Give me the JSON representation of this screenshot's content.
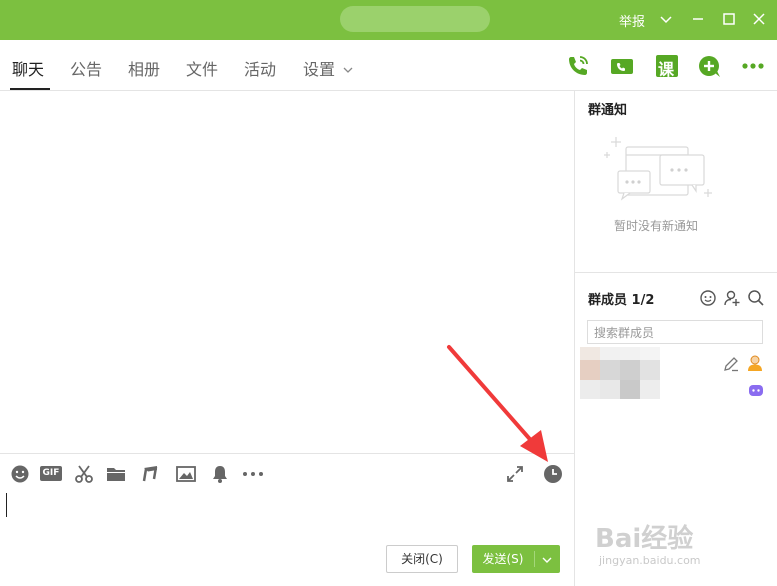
{
  "window": {
    "title_bar_color": "#7cc040",
    "report_label": "举报",
    "controls": [
      "chevron-down-icon",
      "minimize-icon",
      "maximize-icon",
      "close-icon"
    ]
  },
  "tabs": [
    {
      "label": "聊天",
      "active": true
    },
    {
      "label": "公告",
      "active": false
    },
    {
      "label": "相册",
      "active": false
    },
    {
      "label": "文件",
      "active": false
    },
    {
      "label": "活动",
      "active": false
    },
    {
      "label": "设置",
      "active": false
    }
  ],
  "top_actions": [
    "phone-call-icon",
    "video-call-icon",
    "lesson-icon",
    "add-icon",
    "more-icon"
  ],
  "lesson_icon_char": "课",
  "toolbar": {
    "gif_label": "GIF",
    "tools": [
      "emoji-icon",
      "gif-icon",
      "scissors-icon",
      "folder-icon",
      "music-icon",
      "image-icon",
      "bell-icon",
      "more-dots-icon",
      "expand-icon",
      "clock-icon"
    ]
  },
  "buttons": {
    "close_label": "关闭(C)",
    "send_label": "发送(S)"
  },
  "sidebar": {
    "notice_title": "群通知",
    "notice_empty": "暂时没有新通知",
    "members_title": "群成员 1/2",
    "member_search_placeholder": "搜索群成员"
  },
  "watermark": {
    "brand": "Bai经验",
    "url": "jingyan.baidu.com"
  },
  "colors": {
    "accent": "#7cc040",
    "annotation_arrow": "#f03a3a"
  }
}
